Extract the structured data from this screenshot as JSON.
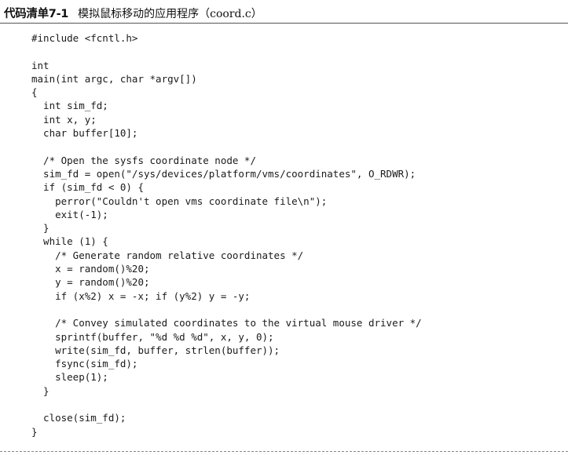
{
  "title": {
    "label": "代码清单7-1",
    "text": "模拟鼠标移动的应用程序（coord.c）"
  },
  "code": {
    "lines": [
      "#include <fcntl.h>",
      "",
      "int",
      "main(int argc, char *argv[])",
      "{",
      "  int sim_fd;",
      "  int x, y;",
      "  char buffer[10];",
      "",
      "  /* Open the sysfs coordinate node */",
      "  sim_fd = open(\"/sys/devices/platform/vms/coordinates\", O_RDWR);",
      "  if (sim_fd < 0) {",
      "    perror(\"Couldn't open vms coordinate file\\n\");",
      "    exit(-1);",
      "  }",
      "  while (1) {",
      "    /* Generate random relative coordinates */",
      "    x = random()%20;",
      "    y = random()%20;",
      "    if (x%2) x = -x; if (y%2) y = -y;",
      "",
      "    /* Convey simulated coordinates to the virtual mouse driver */",
      "    sprintf(buffer, \"%d %d %d\", x, y, 0);",
      "    write(sim_fd, buffer, strlen(buffer));",
      "    fsync(sim_fd);",
      "    sleep(1);",
      "  }",
      "",
      "  close(sim_fd);",
      "}"
    ]
  }
}
